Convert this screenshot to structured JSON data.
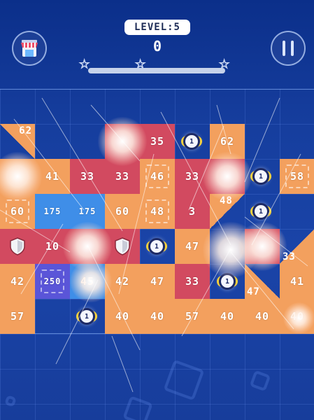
{
  "header": {
    "level_label": "LEVEL:5",
    "score": "0",
    "stars": [
      "star",
      "star",
      "star"
    ],
    "progress": 0.0,
    "shop_button_icon": "shop-stall-icon",
    "pause_button_icon": "pause-icon"
  },
  "board": {
    "row1": {
      "c0": "62",
      "c4": "35",
      "c5": "1",
      "c6": "62"
    },
    "row2": {
      "c1": "41",
      "c2": "33",
      "c3": "33",
      "c4": "46",
      "c5": "33",
      "c7": "1",
      "c8": "58"
    },
    "row3": {
      "c0": "60",
      "c1": "175",
      "c2": "175",
      "c3": "60",
      "c4": "48",
      "c5": "3",
      "c6": "48",
      "c7": "1"
    },
    "row4": {
      "c1": "10",
      "c3": "shield",
      "c4": "1",
      "c5": "47",
      "c8": "33"
    },
    "row5": {
      "c0": "42",
      "c1": "250",
      "c2": "45",
      "c3": "42",
      "c4": "47",
      "c5": "33",
      "c6": "1",
      "c7": "47",
      "c8": "41"
    },
    "row6": {
      "c0": "57",
      "c2": "1",
      "c3": "40",
      "c4": "40",
      "c5": "57",
      "c6": "40",
      "c7": "40",
      "c8": "40"
    }
  },
  "colors": {
    "background": "#163e9e",
    "orange_block": "#f3a05e",
    "red_block": "#d24a60",
    "blue_block": "#3f8ee8",
    "purple_block": "#5a55d8",
    "ball_ring": "#1d2a66"
  }
}
